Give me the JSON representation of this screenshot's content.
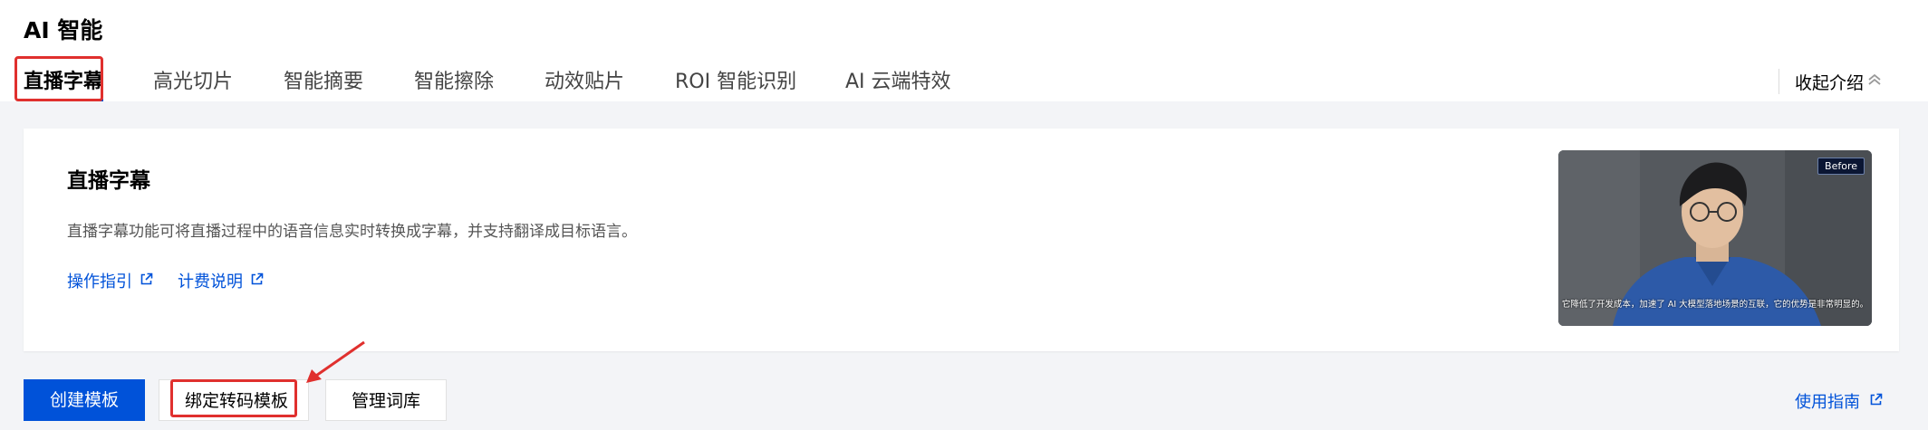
{
  "page": {
    "title": "AI 智能"
  },
  "tabs": [
    {
      "label": "直播字幕",
      "active": true
    },
    {
      "label": "高光切片",
      "active": false
    },
    {
      "label": "智能摘要",
      "active": false
    },
    {
      "label": "智能擦除",
      "active": false
    },
    {
      "label": "动效贴片",
      "active": false
    },
    {
      "label": "ROI 智能识别",
      "active": false
    },
    {
      "label": "AI 云端特效",
      "active": false
    }
  ],
  "collapse": {
    "label": "收起介绍",
    "icon": "double-chevron-up-icon"
  },
  "intro": {
    "title": "直播字幕",
    "description": "直播字幕功能可将直播过程中的语音信息实时转换成字幕，并支持翻译成目标语言。",
    "links": [
      {
        "label": "操作指引",
        "icon": "external-link-icon"
      },
      {
        "label": "计费说明",
        "icon": "external-link-icon"
      }
    ],
    "preview": {
      "badge": "Before",
      "caption": "它降低了开发成本，加速了 AI 大模型落地场景的互联，它的优势是非常明显的。"
    }
  },
  "actions": {
    "create": "创建模板",
    "bind": "绑定转码模板",
    "manage": "管理词库",
    "guide": "使用指南"
  },
  "colors": {
    "primary": "#0052d9",
    "annotation": "#e0302e",
    "background": "#f3f4f7"
  }
}
